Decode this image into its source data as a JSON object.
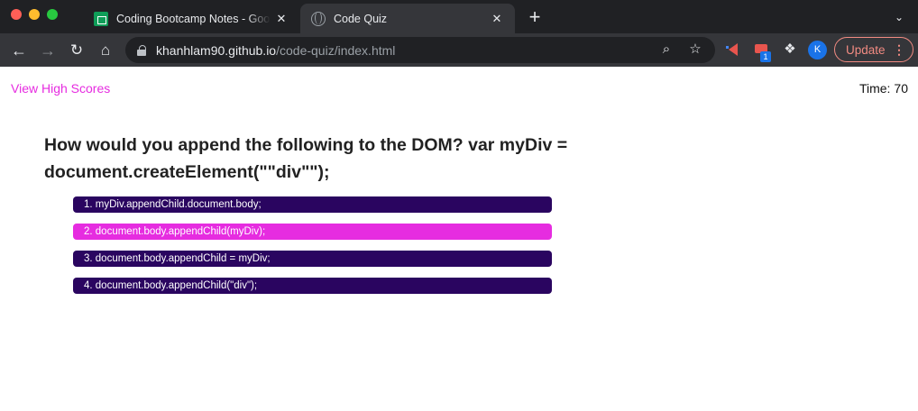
{
  "browser": {
    "tabs": [
      {
        "title": "Coding Bootcamp Notes - Goo",
        "favicon": "sheets-icon",
        "active": false
      },
      {
        "title": "Code Quiz",
        "favicon": "globe-icon",
        "active": true
      }
    ],
    "address": {
      "host": "khanhlam90.github.io",
      "path": "/code-quiz/index.html"
    },
    "extension_badge": "1",
    "profile_initial": "K",
    "update_label": "Update"
  },
  "page": {
    "high_scores_link": "View High Scores",
    "timer_label": "Time:",
    "timer_value": "70",
    "question": "How would you append the following to the DOM? var myDiv = document.createElement(\"\"div\"\");",
    "choices": [
      {
        "label": "1. myDiv.appendChild.document.body;"
      },
      {
        "label": "2. document.body.appendChild(myDiv);"
      },
      {
        "label": "3. document.body.appendChild = myDiv;"
      },
      {
        "label": "4. document.body.appendChild(\"div\");"
      }
    ],
    "colors": {
      "accent": "#e62ce0",
      "choice_bg": "#2a0560"
    }
  }
}
